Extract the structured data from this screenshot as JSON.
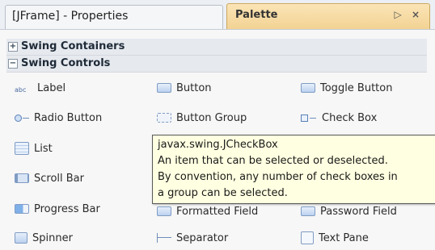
{
  "tabs": {
    "properties_title": "[JFrame] - Properties",
    "palette_title": "Palette",
    "palette_buttons": "▷ ×"
  },
  "categories": {
    "containers": {
      "toggle": "+",
      "label": "Swing Containers"
    },
    "controls": {
      "toggle": "−",
      "label": "Swing Controls"
    }
  },
  "items": {
    "label": "Label",
    "button": "Button",
    "toggle_button": "Toggle Button",
    "radio_button": "Radio Button",
    "button_group": "Button Group",
    "check_box": "Check Box",
    "list": "List",
    "scroll_bar": "Scroll Bar",
    "progress_bar": "Progress Bar",
    "formatted_field": "Formatted Field",
    "password_field": "Password Field",
    "spinner": "Spinner",
    "separator": "Separator",
    "text_pane": "Text Pane"
  },
  "tooltip": {
    "line1": "javax.swing.JCheckBox",
    "line2": "An item that can be selected or deselected.",
    "line3": "By convention, any number of check boxes in",
    "line4": "a group can be selected."
  }
}
